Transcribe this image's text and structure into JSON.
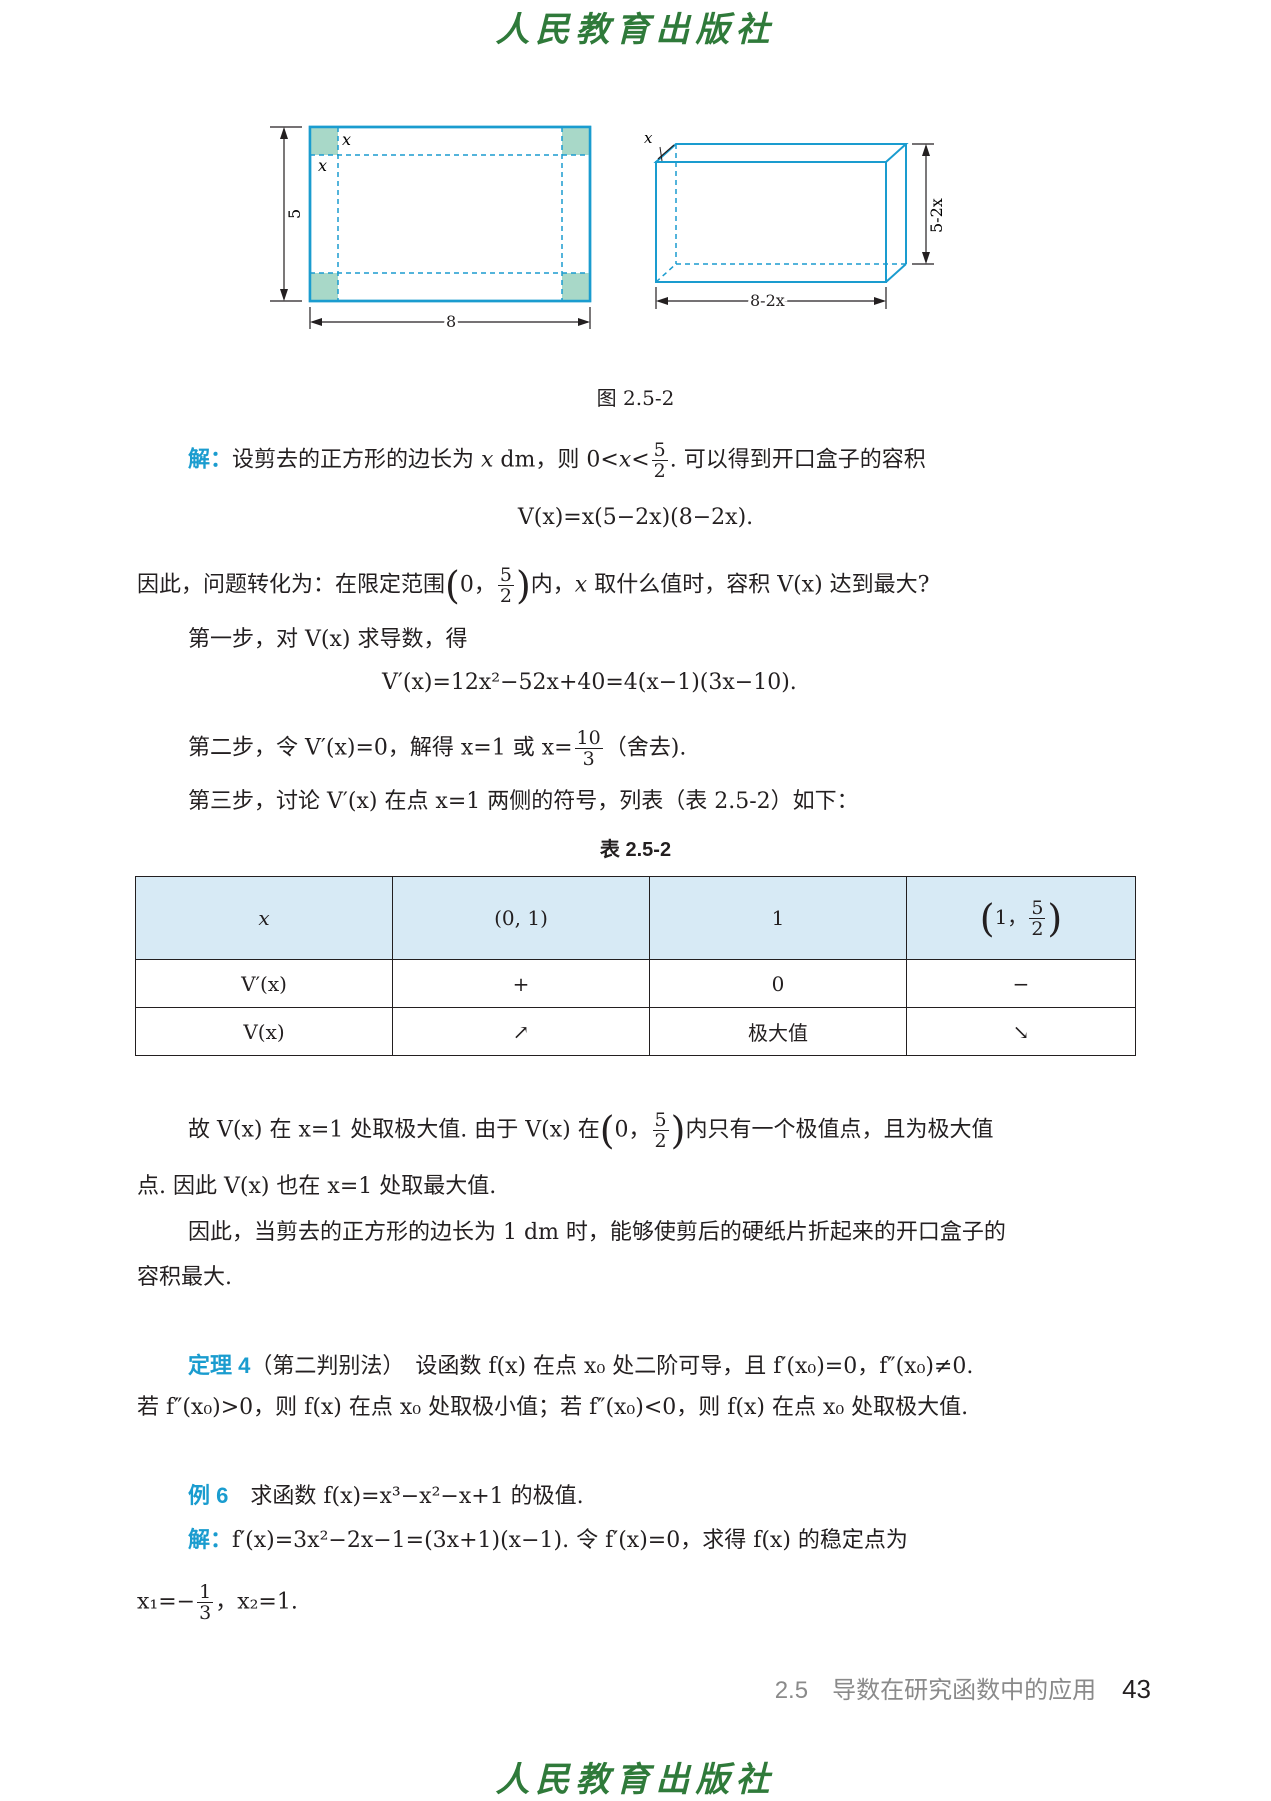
{
  "publisher": "人民教育出版社",
  "figure": {
    "caption": "图 2.5-2",
    "left": {
      "x_top": "x",
      "x_side": "x",
      "height_label": "5",
      "width_label": "8"
    },
    "right": {
      "x_label": "x",
      "height_label": "5-2x",
      "width_label": "8-2x"
    }
  },
  "text": {
    "sol_label": "解：",
    "sol_line1a": "设剪去的正方形的边长为 ",
    "sol_line1_x": "x",
    "sol_line1b": " dm，则 0<",
    "sol_line1_x2": "x",
    "sol_line1c": "<",
    "frac_52_n": "5",
    "frac_52_d": "2",
    "sol_line1d": ". 可以得到开口盒子的容积",
    "volume_formula": "V(x)=x(5−2x)(8−2x).",
    "problem_a": "因此，问题转化为：在限定范围",
    "problem_b": "0，",
    "problem_c": "内，",
    "problem_x": "x",
    "problem_d": " 取什么值时，容积 V(x) 达到最大?",
    "step1": "第一步，对 V(x) 求导数，得",
    "derivative": "V′(x)=12x²−52x+40=4(x−1)(3x−10).",
    "step2a": "第二步，令 V′(x)=0，解得 x=1 或 x=",
    "frac_103_n": "10",
    "frac_103_d": "3",
    "step2b": "（舍去).",
    "step3": "第三步，讨论 V′(x) 在点 x=1 两侧的符号，列表（表 2.5-2）如下：",
    "table_caption": "表 2.5-2",
    "concl1a": "故 V(x) 在 x=1 处取极大值. 由于 V(x) 在",
    "concl1b": "0，",
    "concl1c": "内只有一个极值点，且为极大值",
    "concl2": "点. 因此 V(x) 也在 x=1 处取最大值.",
    "concl3": "因此，当剪去的正方形的边长为 1 dm 时，能够使剪后的硬纸片折起来的开口盒子的",
    "concl4": "容积最大.",
    "thm_label": "定理 4",
    "thm_line1": "（第二判别法）　设函数 f(x) 在点 x₀ 处二阶可导，且 f′(x₀)=0，f″(x₀)≠0.",
    "thm_line2": "若 f″(x₀)>0，则 f(x) 在点 x₀ 处取极小值；若 f″(x₀)<0，则 f(x) 在点 x₀ 处取极大值.",
    "ex_label": "例 6",
    "ex_text": "求函数 f(x)=x³−x²−x+1 的极值.",
    "ex_sol_label": "解：",
    "ex_sol_text": "f′(x)=3x²−2x−1=(3x+1)(x−1). 令 f′(x)=0，求得 f(x) 的稳定点为",
    "ex_x1": "x₁=−",
    "frac_13_n": "1",
    "frac_13_d": "3",
    "ex_x2": "，x₂=1."
  },
  "table": {
    "header": [
      "x",
      "(0, 1)",
      "1"
    ],
    "header_last_a": "1，",
    "header_last_n": "5",
    "header_last_d": "2",
    "row1": [
      "V′(x)",
      "+",
      "0",
      "−"
    ],
    "row2": [
      "V(x)",
      "↗",
      "极大值",
      "↘"
    ]
  },
  "footer": {
    "section": "2.5　导数在研究函数中的应用",
    "page": "43"
  },
  "colors": {
    "teal": "#1a9ccf",
    "table_header_bg": "#d7eaf5",
    "square_fill": "#a8d8c8"
  }
}
